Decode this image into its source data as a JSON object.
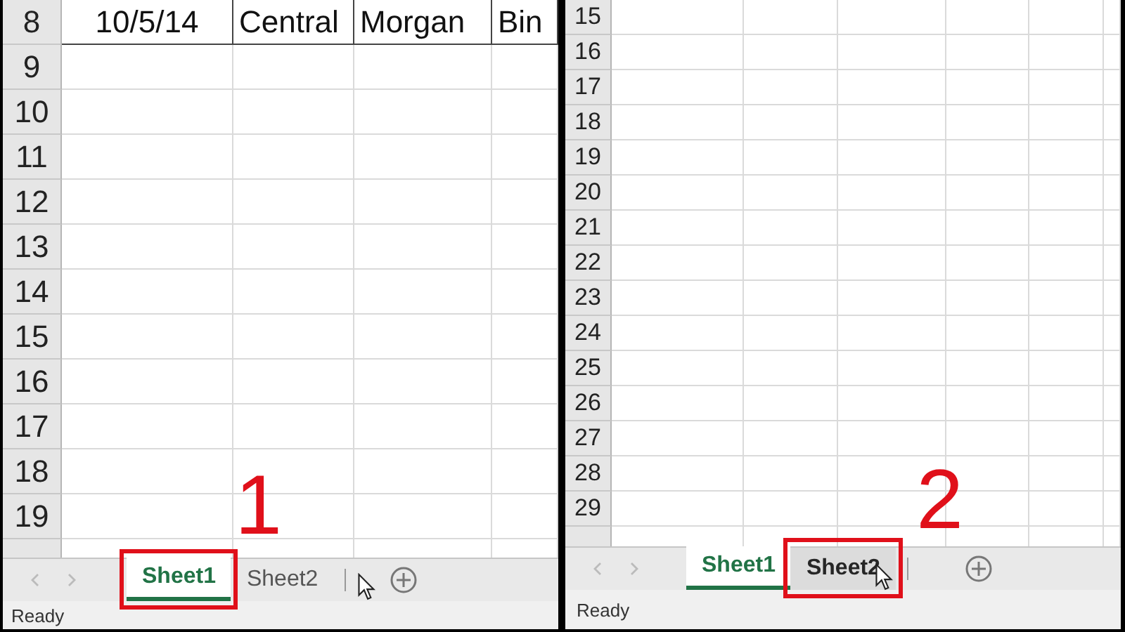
{
  "panels": [
    {
      "step": "1",
      "rows": [
        {
          "header": "8",
          "cells": [
            "10/5/14",
            "Central",
            "Morgan",
            "Bin"
          ]
        },
        {
          "header": "9"
        },
        {
          "header": "10"
        },
        {
          "header": "11"
        },
        {
          "header": "12"
        },
        {
          "header": "13"
        },
        {
          "header": "14"
        },
        {
          "header": "15"
        },
        {
          "header": "16"
        },
        {
          "header": "17"
        },
        {
          "header": "18"
        },
        {
          "header": "19"
        }
      ],
      "tabs": [
        {
          "label": "Sheet1",
          "selected": true,
          "hovered": false,
          "highlighted": true
        },
        {
          "label": "Sheet2",
          "selected": false,
          "hovered": false,
          "highlighted": false
        }
      ],
      "status": "Ready"
    },
    {
      "step": "2",
      "rows": [
        {
          "header": "15"
        },
        {
          "header": "16"
        },
        {
          "header": "17"
        },
        {
          "header": "18"
        },
        {
          "header": "19"
        },
        {
          "header": "20"
        },
        {
          "header": "21"
        },
        {
          "header": "22"
        },
        {
          "header": "23"
        },
        {
          "header": "24"
        },
        {
          "header": "25"
        },
        {
          "header": "26"
        },
        {
          "header": "27"
        },
        {
          "header": "28"
        },
        {
          "header": "29"
        }
      ],
      "tabs": [
        {
          "label": "Sheet1",
          "selected": true,
          "hovered": false,
          "highlighted": false
        },
        {
          "label": "Sheet2",
          "selected": false,
          "hovered": true,
          "highlighted": true
        }
      ],
      "status": "Ready"
    }
  ]
}
